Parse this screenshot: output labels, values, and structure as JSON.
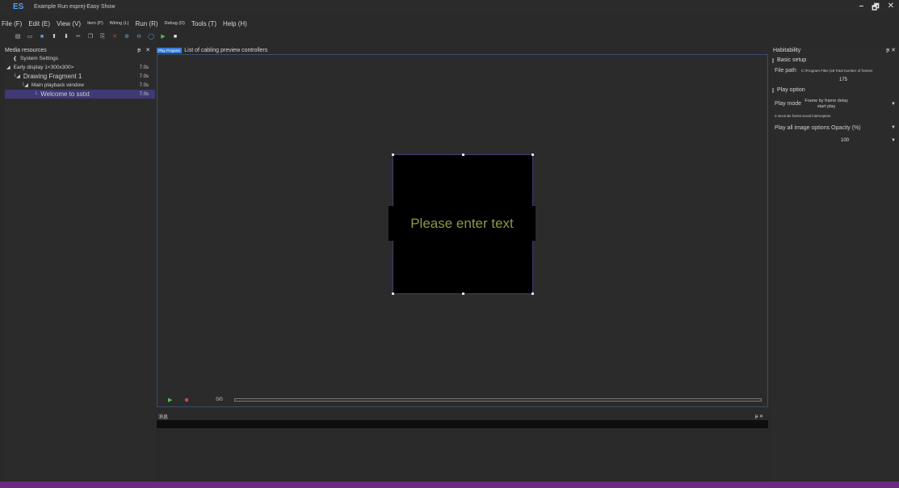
{
  "window": {
    "logo": "ES",
    "title": "Example Run esprej-Easy Show",
    "controls": {
      "minimize": "–",
      "restore": "🗗",
      "close": "✕"
    }
  },
  "menu": [
    {
      "label": "File (F)",
      "small": false
    },
    {
      "label": "Edit (E)",
      "small": false
    },
    {
      "label": "View (V)",
      "small": false
    },
    {
      "label": "Item (P)",
      "small": true
    },
    {
      "label": "Wiring (L)",
      "small": true
    },
    {
      "label": "Run (R)",
      "small": false
    },
    {
      "label": "Debug (D)",
      "small": true
    },
    {
      "label": "Tools (T)",
      "small": false
    },
    {
      "label": "Help (H)",
      "small": false
    }
  ],
  "left_panel": {
    "title": "Media resources",
    "controls": "ᵽ ✕",
    "tree": [
      {
        "label": "System Settings",
        "duration": "",
        "indent": 10,
        "prefix": "❰",
        "selected": false,
        "big": false
      },
      {
        "label": "Early display 1<300x300>",
        "duration": "7.0s",
        "indent": 2,
        "prefix": "◢",
        "selected": false,
        "big": false
      },
      {
        "label": "Drawing Fragment 1",
        "duration": "7.0s",
        "indent": 10,
        "prefix": "└◢",
        "selected": false,
        "big": true
      },
      {
        "label": "Main playback window",
        "duration": "7.0s",
        "indent": 20,
        "prefix": "└◢",
        "selected": false,
        "big": false
      },
      {
        "label": "Welcome to sstxt",
        "duration": "7.0s",
        "indent": 36,
        "prefix": "└",
        "selected": true,
        "big": true
      }
    ]
  },
  "center": {
    "tab_active": "Play Program",
    "tab_title": "List of cabling preview controllers",
    "canvas_text": "Please enter text",
    "playbar": {
      "count": "0/0"
    },
    "message_panel": {
      "title": "消息",
      "controls": "ᵽ ✕"
    }
  },
  "right_panel": {
    "title": "Habitability",
    "controls": "ᵽ ✕",
    "basic_setup": "Basic setup",
    "file_path_label": "File path",
    "file_path_value": "C:\\Program Files (x8 Total number of frames",
    "total_frames": "175",
    "play_option": "Play option",
    "play_mode_label": "Play mode",
    "play_mode_value": "Frame by frame delay start play",
    "interception": "0 seconds forest wood interception",
    "image_options_label": "Play all image options Opacity (%)",
    "opacity": "100"
  },
  "colors": {
    "accent": "#3a7bd5",
    "selected_row": "#3f3975",
    "status_bar": "#6c2a80",
    "canvas_text": "#8a9a44",
    "play_green": "#4ec04e",
    "stop_red": "#d04040"
  }
}
